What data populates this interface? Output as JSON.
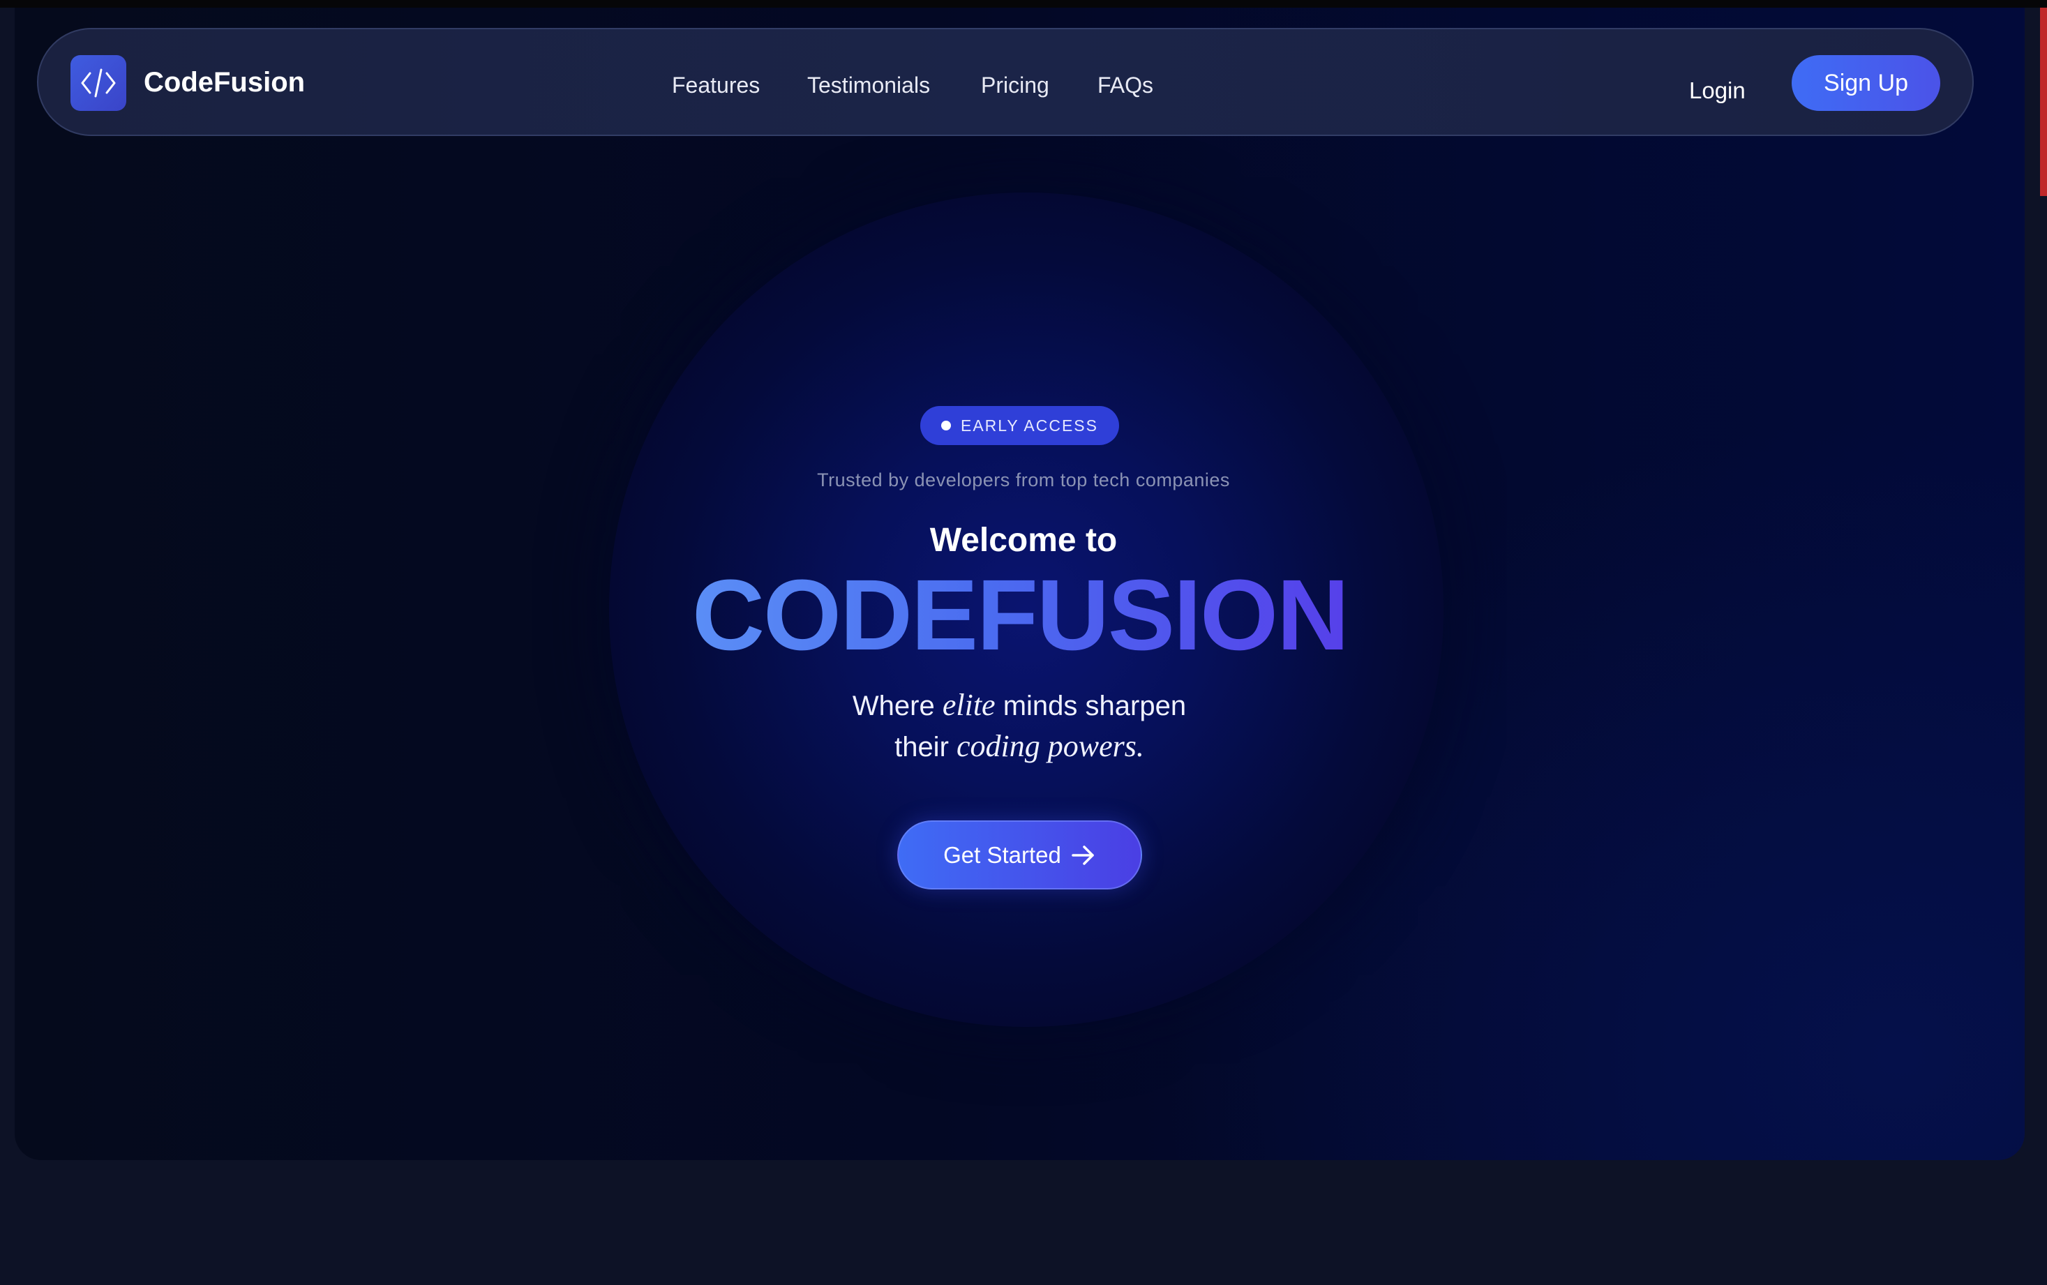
{
  "brand": {
    "name": "CodeFusion",
    "logo_icon": "code-brackets-icon"
  },
  "nav": {
    "links": [
      "Features",
      "Testimonials",
      "Pricing",
      "FAQs"
    ],
    "login_label": "Login",
    "signup_label": "Sign Up"
  },
  "hero": {
    "badge_label": "EARLY ACCESS",
    "trusted_text": "Trusted by developers from top tech companies",
    "welcome_text": "Welcome to",
    "title": "CODEFUSION",
    "tagline": {
      "line1_pre": "Where",
      "line1_em": "elite",
      "line1_post": "minds sharpen",
      "line2_pre": "their",
      "line2_em": "coding powers."
    },
    "cta_label": "Get Started",
    "cta_icon": "arrow-right-icon"
  },
  "colors": {
    "accent": "#3f6cf5",
    "accent_purple": "#5640ea",
    "badge": "#2f3fd8",
    "background": "#0d1226"
  }
}
